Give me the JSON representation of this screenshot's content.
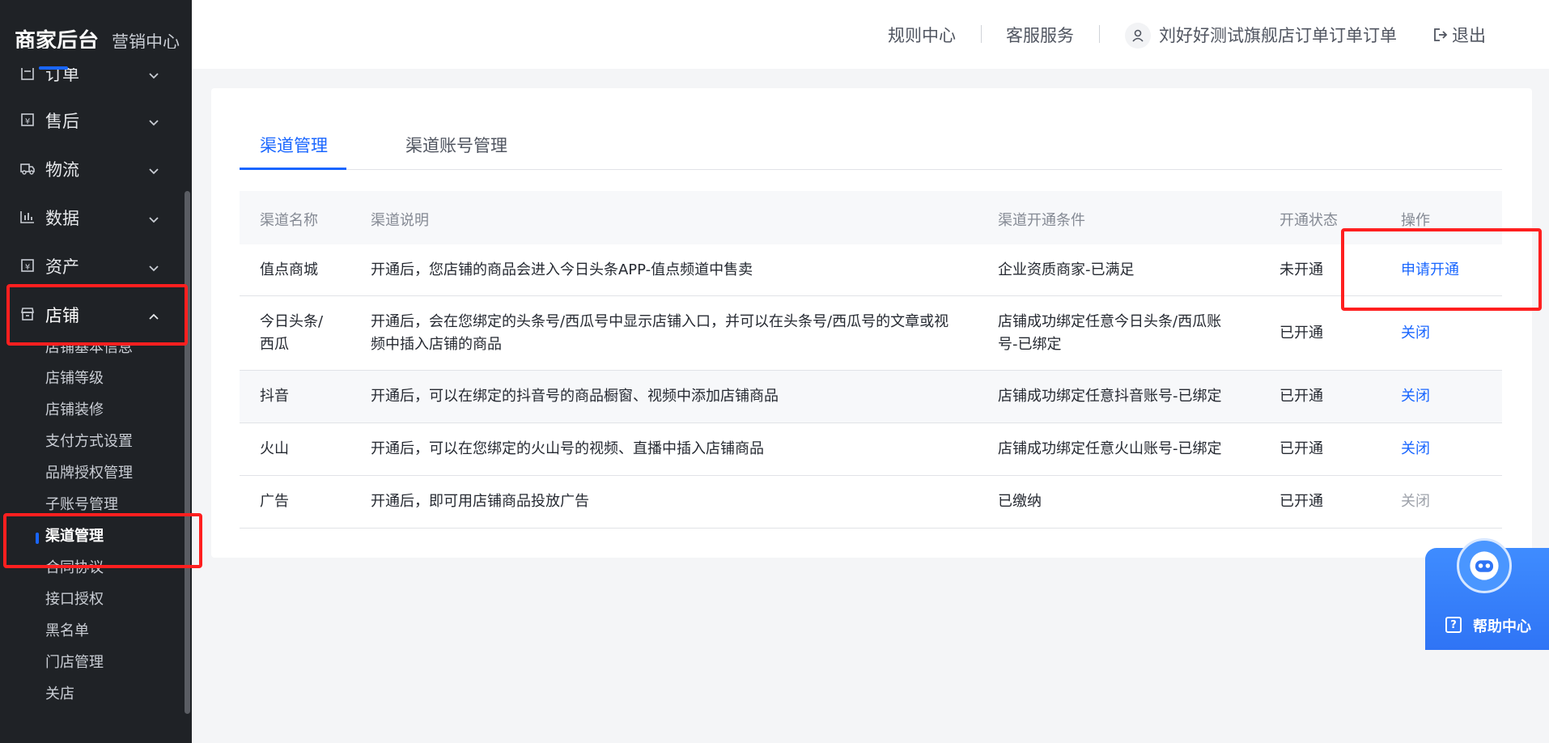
{
  "brand": {
    "main": "商家后台",
    "sub": "营销中心"
  },
  "sidebar": {
    "items": [
      {
        "label": "订单",
        "icon": "order-icon"
      },
      {
        "label": "售后",
        "icon": "aftersale-icon"
      },
      {
        "label": "物流",
        "icon": "truck-icon"
      },
      {
        "label": "数据",
        "icon": "chart-icon"
      },
      {
        "label": "资产",
        "icon": "asset-icon"
      },
      {
        "label": "店铺",
        "icon": "shop-icon"
      }
    ],
    "sub_items": [
      "店铺基本信息",
      "店铺等级",
      "店铺装修",
      "支付方式设置",
      "品牌授权管理",
      "子账号管理",
      "渠道管理",
      "合同协议",
      "接口授权",
      "黑名单",
      "门店管理",
      "关店"
    ],
    "active_sub": "渠道管理"
  },
  "header": {
    "rules": "规则中心",
    "service": "客服服务",
    "user": "刘好好测试旗舰店订单订单订单",
    "logout": "退出"
  },
  "tabs": [
    "渠道管理",
    "渠道账号管理"
  ],
  "table": {
    "columns": [
      "渠道名称",
      "渠道说明",
      "渠道开通条件",
      "开通状态",
      "操作"
    ],
    "rows": [
      {
        "name": "值点商城",
        "desc": "开通后，您店铺的商品会进入今日头条APP-值点频道中售卖",
        "cond": "企业资质商家-已满足",
        "status": "未开通",
        "action": "申请开通"
      },
      {
        "name_1": "今日头条/",
        "name_2": "西瓜",
        "desc_1": "开通后，会在您绑定的头条号/西瓜号中显示店铺入口，并可以在头条号/西瓜号的文章或视",
        "desc_2": "频中插入店铺的商品",
        "cond_1": "店铺成功绑定任意今日头条/西瓜账",
        "cond_2": "号-已绑定",
        "status": "已开通",
        "action": "关闭"
      },
      {
        "name": "抖音",
        "desc": "开通后，可以在绑定的抖音号的商品橱窗、视频中添加店铺商品",
        "cond": "店铺成功绑定任意抖音账号-已绑定",
        "status": "已开通",
        "action": "关闭"
      },
      {
        "name": "火山",
        "desc": "开通后，可以在您绑定的火山号的视频、直播中插入店铺商品",
        "cond": "店铺成功绑定任意火山账号-已绑定",
        "status": "已开通",
        "action": "关闭"
      },
      {
        "name": "广告",
        "desc": "开通后，即可用店铺商品投放广告",
        "cond": "已缴纳",
        "status": "已开通",
        "action": "关闭"
      }
    ]
  },
  "help": {
    "label": "帮助中心",
    "icon": "robot-icon"
  },
  "colors": {
    "accent": "#1966ff",
    "sidebar_bg": "#1f2226",
    "annotation": "#ff1f1f"
  }
}
